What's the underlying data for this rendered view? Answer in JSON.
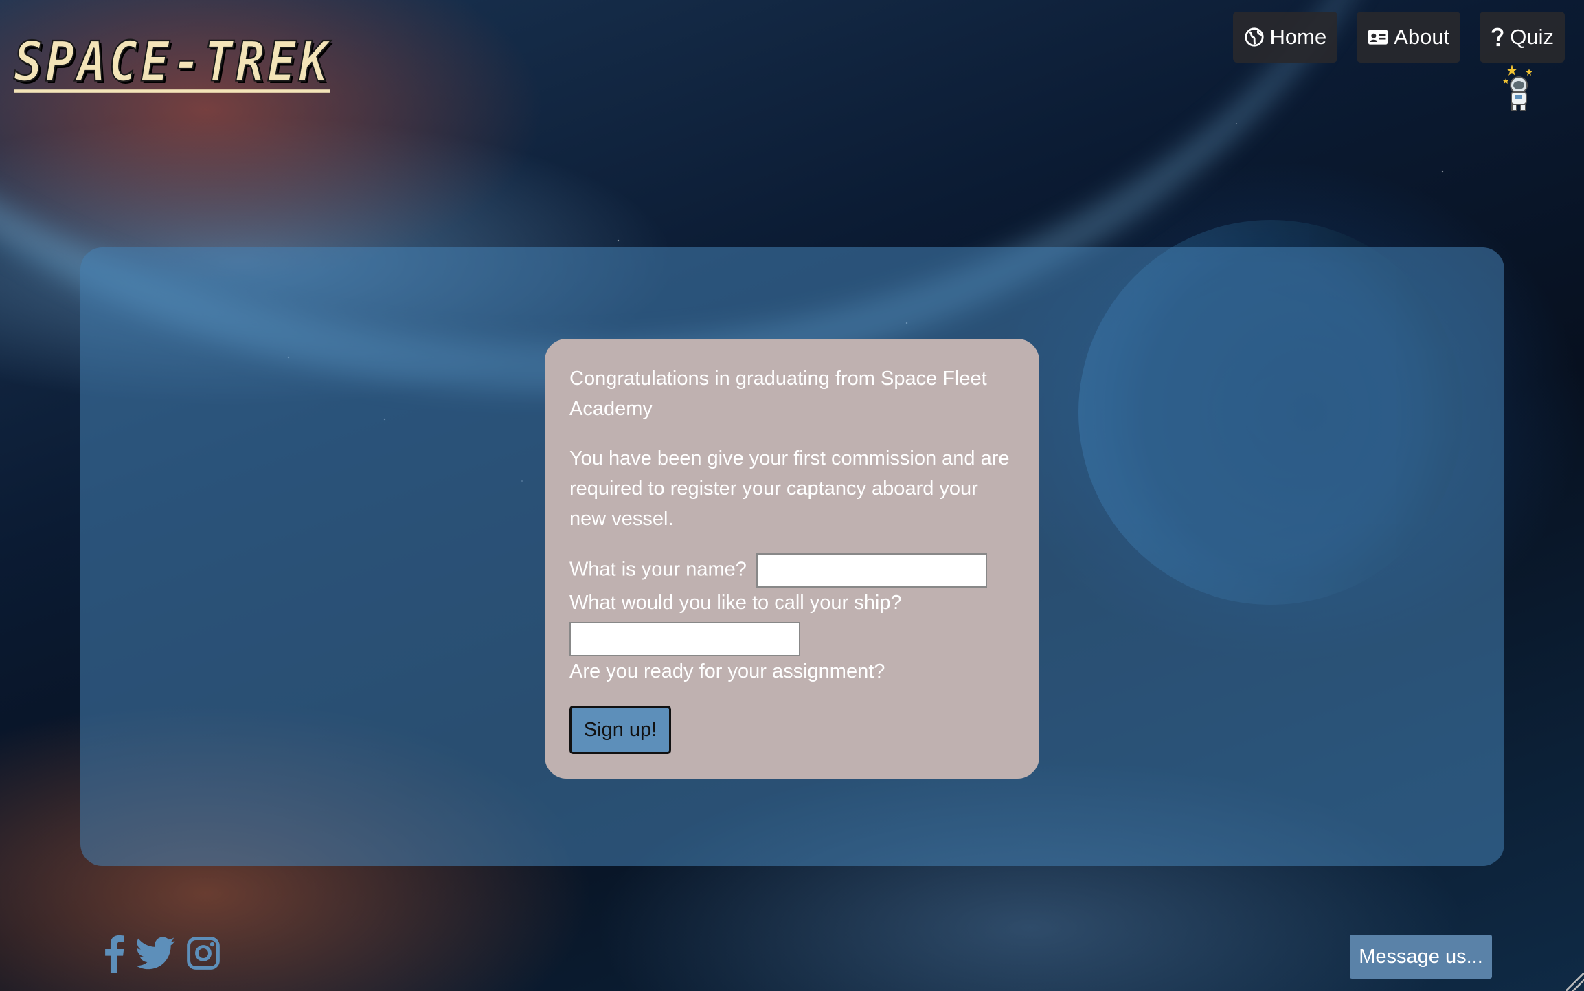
{
  "header": {
    "logo_text": "SPACE-TREK",
    "nav": [
      {
        "label": "Home",
        "icon": "globe-icon"
      },
      {
        "label": "About",
        "icon": "id-card-icon"
      },
      {
        "label": "Quiz",
        "icon": "question-icon"
      }
    ],
    "mascot_icon": "astronaut-icon"
  },
  "card": {
    "intro": "Congratulations in graduating from Space Fleet Academy",
    "body": "You have been give your first commission and are required to register your captancy aboard your new vessel.",
    "name_label": "What is your name?",
    "name_value": "",
    "ship_label": "What would you like to call your ship?",
    "ship_value": "",
    "ready_label": "Are you ready for your assignment?",
    "signup_label": "Sign up!"
  },
  "footer": {
    "social_icons": [
      "facebook-icon",
      "twitter-icon",
      "instagram-icon"
    ],
    "message_label": "Message us..."
  },
  "colors": {
    "accent": "#5d8fba",
    "card_bg": "#bfb1b0",
    "nav_bg": "#28282c",
    "logo": "#f3e4b8"
  }
}
